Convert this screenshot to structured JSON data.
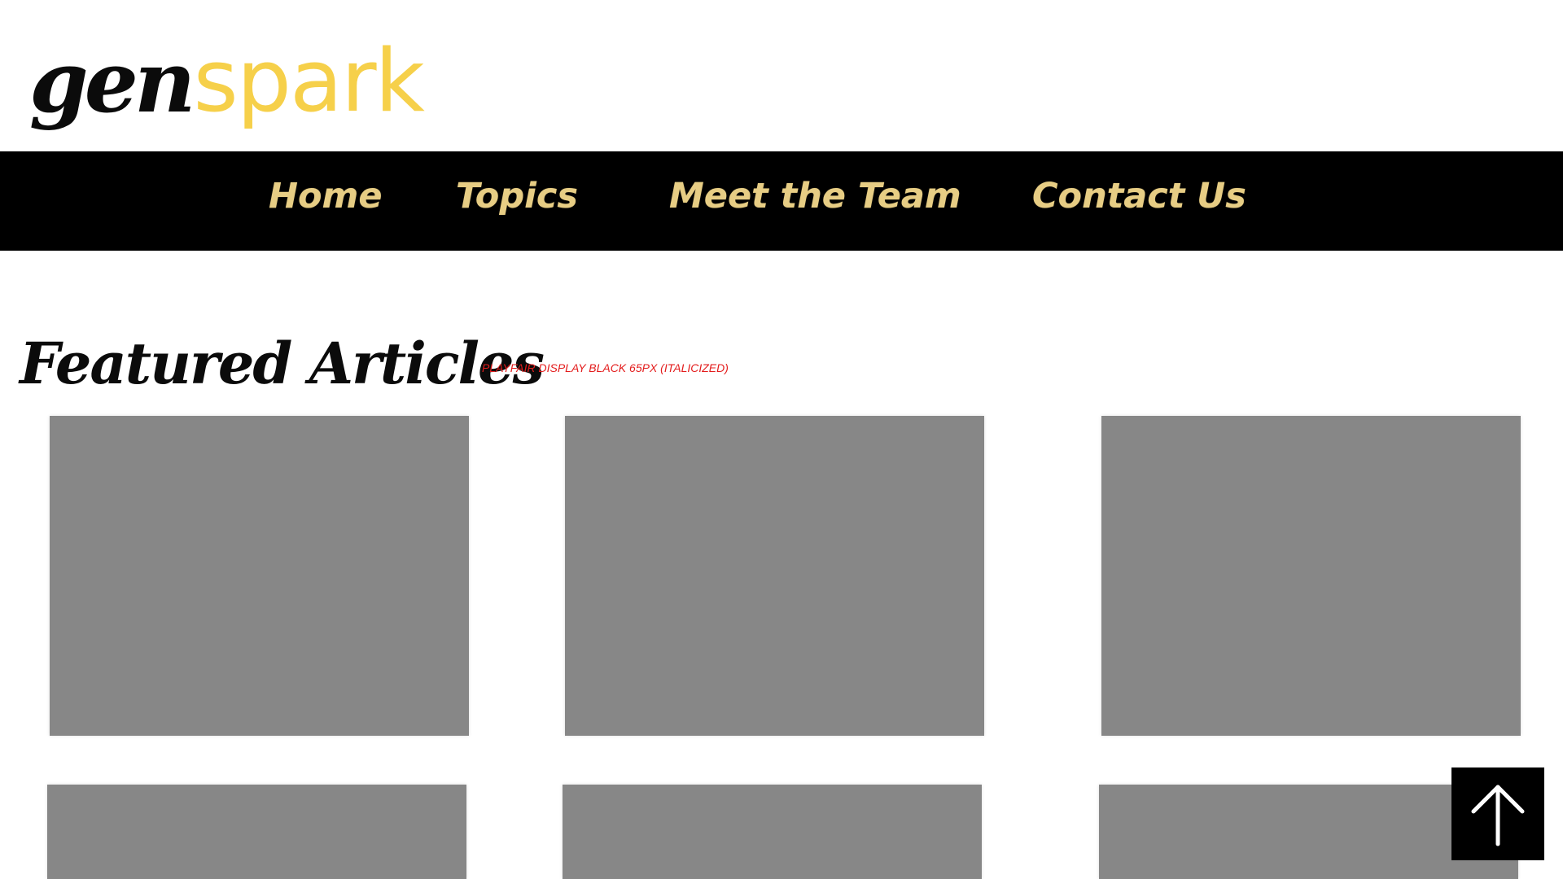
{
  "header": {
    "logo": {
      "part1": "gen",
      "part2": "spark"
    }
  },
  "nav": {
    "items": [
      {
        "label": "Home"
      },
      {
        "label": "Topics"
      },
      {
        "label": "Meet the Team"
      },
      {
        "label": "Contact Us"
      }
    ]
  },
  "featured": {
    "title": "Featured Articles",
    "design_note": "PLAYFAIR DISPLAY BLACK 65PX (ITALICIZED)",
    "cards_count_visible": 6
  },
  "back_to_top": {
    "icon": "arrow-up-icon"
  },
  "colors": {
    "nav_background": "#000000",
    "nav_text": "#e7cd84",
    "logo_accent": "#f6d04a",
    "logo_dark": "#0b0b0b",
    "placeholder_gray": "#878787",
    "annotation_red": "#e31c1c"
  }
}
